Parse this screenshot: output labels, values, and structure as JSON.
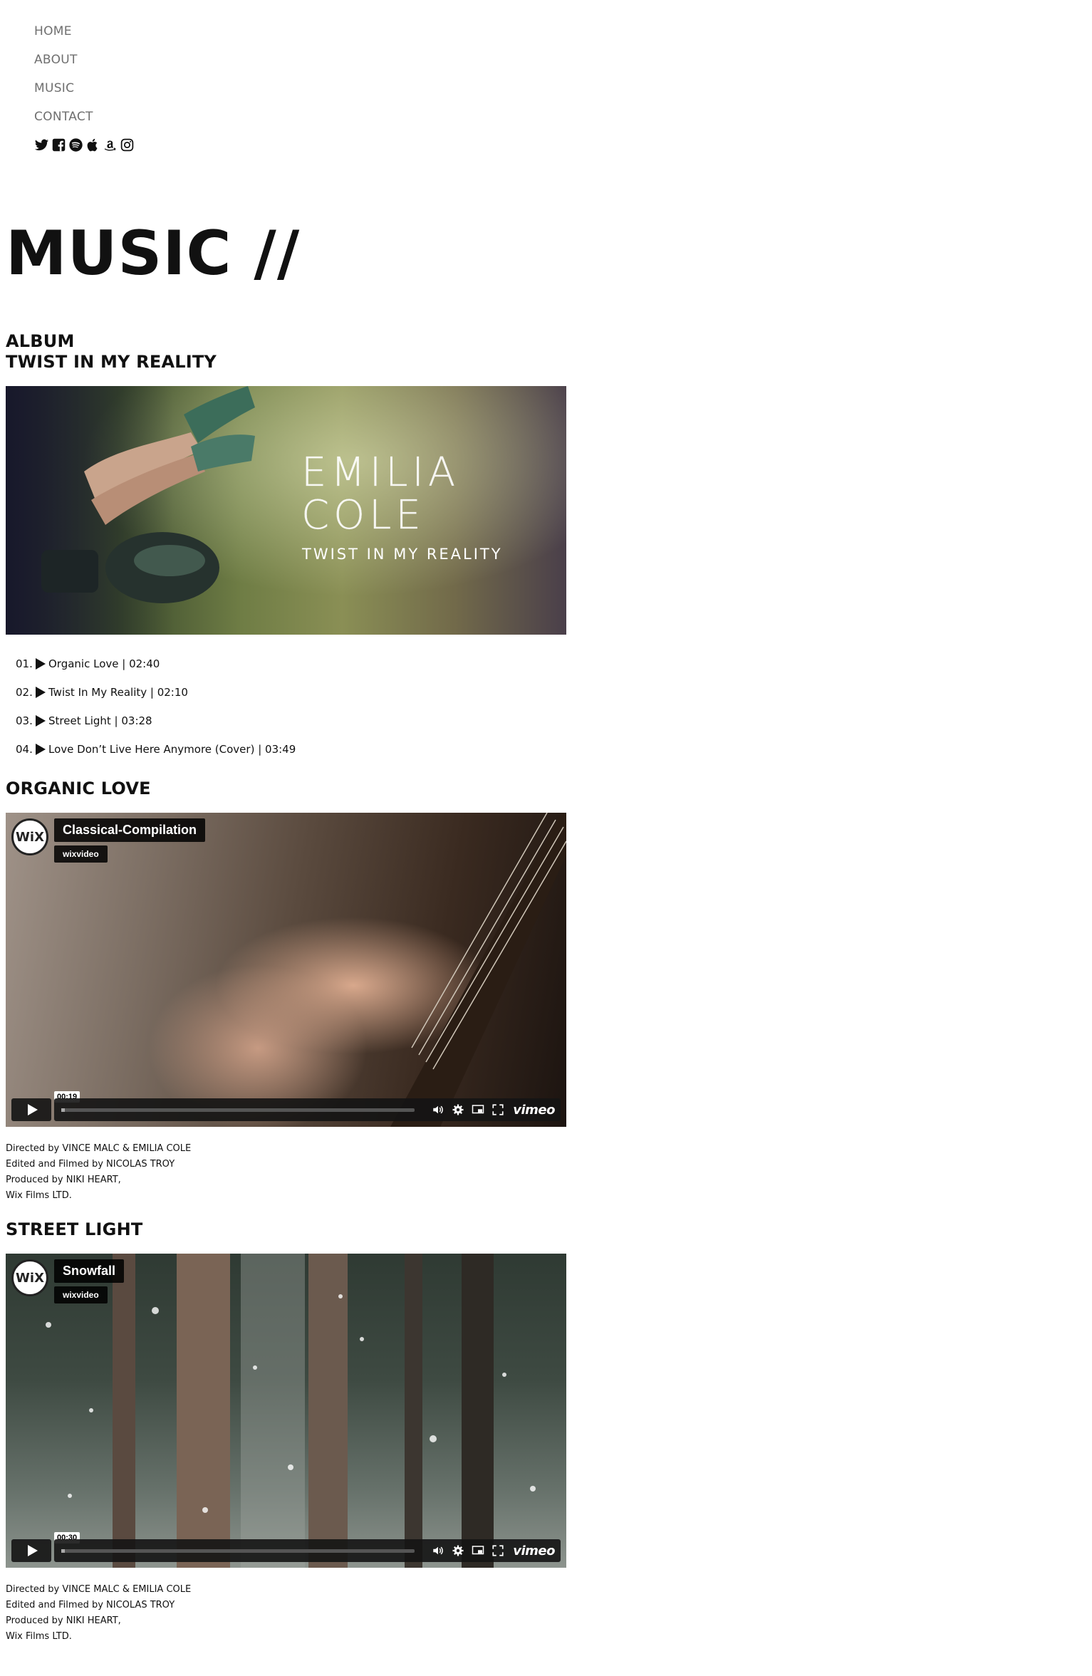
{
  "nav": {
    "items": [
      "HOME",
      "ABOUT",
      "MUSIC",
      "CONTACT"
    ],
    "social": [
      "twitter-icon",
      "facebook-icon",
      "spotify-icon",
      "apple-icon",
      "amazon-icon",
      "instagram-icon"
    ]
  },
  "page": {
    "title": "MUSIC //",
    "album_label": "ALBUM",
    "album_name": "TWIST IN MY REALITY"
  },
  "cover": {
    "artist_line1": "EMILIA",
    "artist_line2": "COLE",
    "album": "TWIST IN MY REALITY"
  },
  "tracks": [
    {
      "num": "01.",
      "title": "Organic Love | 02:40"
    },
    {
      "num": "02.",
      "title": "Twist In My Reality | 02:10"
    },
    {
      "num": "03.",
      "title": "Street Light | 03:28"
    },
    {
      "num": "04.",
      "title": "Love Don’t Live Here Anymore (Cover) | 03:49"
    }
  ],
  "videos": [
    {
      "section_title": "ORGANIC LOVE",
      "logo": "WiX",
      "title": "Classical-Compilation",
      "channel": "wixvideo",
      "time": "00:19",
      "progress": 0.01,
      "brand": "vimeo",
      "credits": [
        "Directed by VINCE MALC & EMILIA COLE",
        "Edited and Filmed by NICOLAS TROY",
        "Produced by NIKI HEART,",
        "Wix Films LTD."
      ]
    },
    {
      "section_title": "STREET LIGHT",
      "logo": "WiX",
      "title": "Snowfall",
      "channel": "wixvideo",
      "time": "00:30",
      "progress": 0.01,
      "brand": "vimeo",
      "credits": [
        "Directed by VINCE MALC & EMILIA COLE",
        "Edited and Filmed by NICOLAS TROY",
        "Produced by NIKI HEART,",
        "Wix Films LTD."
      ]
    }
  ]
}
